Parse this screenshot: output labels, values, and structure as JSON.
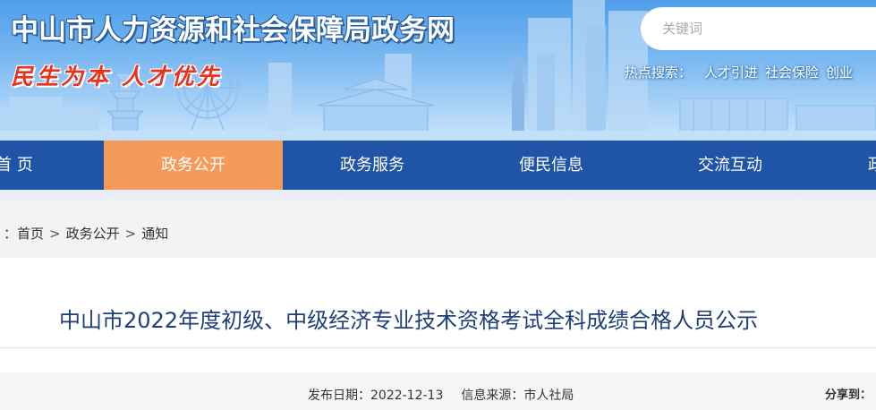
{
  "header": {
    "site_title": "中山市人力资源和社会保障局政务网",
    "slogan": "民生为本 人才优先",
    "colors": {
      "banner_top": "#4f9fe9",
      "banner_bottom": "#c9e3fa",
      "slogan": "#e8321e"
    }
  },
  "search": {
    "placeholder": "关键词",
    "icon": "search-icon"
  },
  "hot_search": {
    "label": "热点搜索：",
    "links": [
      "人才引进",
      "社会保险",
      "创业"
    ]
  },
  "nav": {
    "color": "#1f54a6",
    "active_color": "#f59a5b",
    "items": [
      {
        "label": "首 页",
        "active": false
      },
      {
        "label": "政务公开",
        "active": true
      },
      {
        "label": "政务服务",
        "active": false
      },
      {
        "label": "便民信息",
        "active": false
      },
      {
        "label": "交流互动",
        "active": false
      },
      {
        "label": "政",
        "active": false
      }
    ]
  },
  "breadcrumb": {
    "prefix": "：",
    "items": [
      "首页",
      "政务公开",
      "通知"
    ],
    "separator": ">"
  },
  "article": {
    "title": "中山市2022年度初级、中级经济专业技术资格考试全科成绩合格人员公示",
    "publish_label": "发布日期：",
    "publish_date": "2022-12-13",
    "source_label": "信息来源：",
    "source": "市人社局",
    "share_label": "分享到："
  }
}
